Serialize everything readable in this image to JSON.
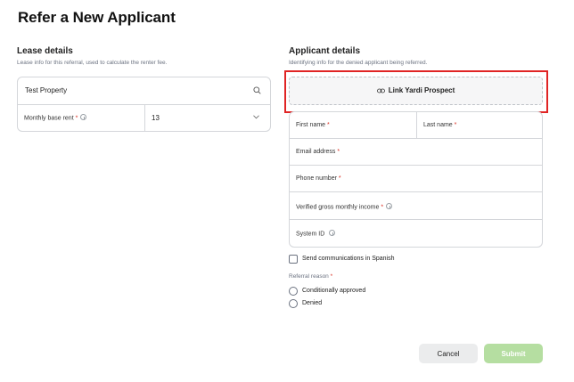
{
  "page": {
    "title": "Refer a New Applicant"
  },
  "lease": {
    "title": "Lease details",
    "subtitle": "Lease info for this referral, used to calculate the renter fee.",
    "property": "Test Property",
    "rent_label": "Monthly base rent",
    "required_mark": "*",
    "rent_value": "13",
    "icons": {
      "search": "search-icon",
      "info": "info-icon",
      "dropdown": "chevron-down-icon"
    }
  },
  "applicant": {
    "title": "Applicant details",
    "subtitle": "Identifying info for the denied applicant being referred.",
    "link_button": "Link Yardi Prospect",
    "link_icon": "link-icon",
    "highlight_color": "#e02424",
    "fields": {
      "first_name": "First name",
      "last_name": "Last name",
      "email": "Email address",
      "phone": "Phone number",
      "income": "Verified gross monthly income",
      "system_id": "System ID"
    },
    "required_mark": "*"
  },
  "options": {
    "spanish_label": "Send communications in Spanish",
    "spanish_checked": false,
    "reason_label": "Referral reason",
    "reason_required": "*",
    "reasons": [
      "Conditionally approved",
      "Denied"
    ]
  },
  "actions": {
    "cancel": "Cancel",
    "submit": "Submit",
    "submit_color": "#b5dea1"
  }
}
